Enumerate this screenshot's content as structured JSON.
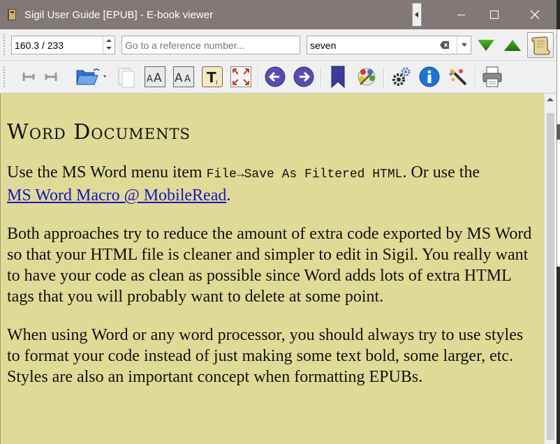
{
  "window": {
    "title": "Sigil User Guide [EPUB] - E-book viewer",
    "min_label": "",
    "max_label": "",
    "close_label": "✕"
  },
  "navbar": {
    "position_value": "160.3 / 233",
    "reference_placeholder": "Go to a reference number...",
    "search_value": "seven"
  },
  "toolbar": {
    "icons": [
      "back-icon",
      "forward-icon",
      "open-folder-icon",
      "copy-icon",
      "font-larger-icon",
      "font-smaller-icon",
      "text-icon",
      "fullscreen-icon",
      "previous-icon",
      "next-icon",
      "bookmark-icon",
      "theme-icon",
      "preferences-icon",
      "info-icon",
      "magic-icon",
      "print-icon"
    ]
  },
  "document": {
    "heading": "Word Documents",
    "p1_text_before": "Use the MS Word menu item ",
    "p1_code": "File→Save As Filtered HTML",
    "p1_text_after": ". Or use the",
    "p1_link": "MS Word Macro @ MobileRead",
    "p1_end": ".",
    "p2": "Both approaches try to reduce the amount of extra code exported by MS Word so that your HTML file is cleaner and simpler to edit in Sigil. You really want to have your code as clean as possible since Word adds lots of extra HTML tags that you will probably want to delete at some point.",
    "p3": "When using Word or any word processor, you should always try to use styles to format your code instead of just making some text bold, some larger, etc. Styles are also an important concept when formatting EPUBs."
  },
  "colors": {
    "title_bar": "#827877",
    "page_background": "#dfdb97",
    "link": "#1515c9",
    "nav_arrow_green": "#2a8a12",
    "toolbar_purple": "#5a4bb0"
  }
}
